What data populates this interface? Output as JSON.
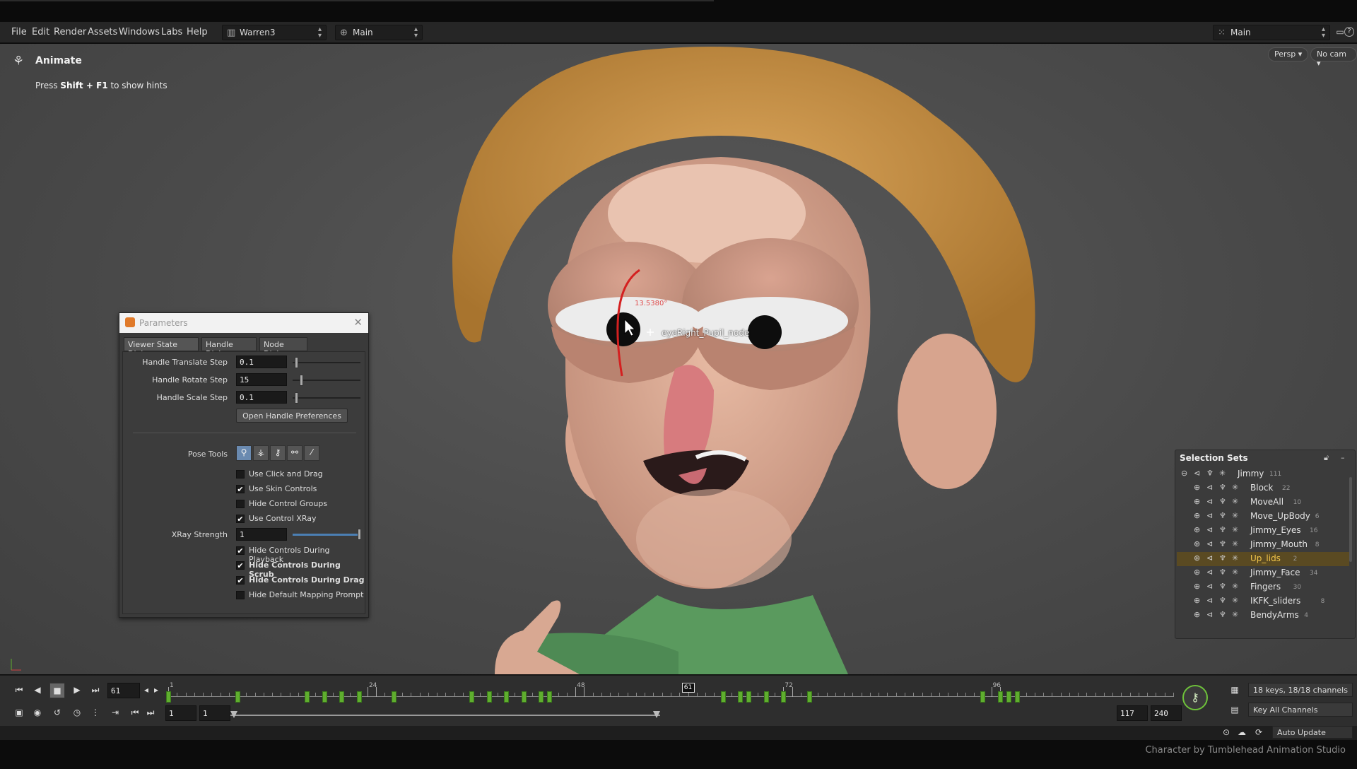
{
  "menubar": {
    "items": [
      "File",
      "Edit",
      "Render",
      "Assets",
      "Windows",
      "Labs",
      "Help"
    ],
    "desktop": "Warren3",
    "context": "Main",
    "right_context": "Main",
    "help_glyph": "?"
  },
  "viewport": {
    "state_title": "Animate",
    "hint_prefix": "Press ",
    "hint_keys": "Shift + F1",
    "hint_suffix": " to show hints",
    "persp_btn": "Persp ▾",
    "cam_btn": "No cam ▾",
    "handle_label": "eyeRight_Pupil_node",
    "handle_value": "13.5380°"
  },
  "parameters": {
    "title": "Parameters",
    "tabs": [
      "Viewer State Dialog",
      "Handle Dialog",
      "Node Dialog"
    ],
    "translate_label": "Handle Translate Step",
    "translate_value": "0.1",
    "rotate_label": "Handle Rotate Step",
    "rotate_value": "15",
    "scale_label": "Handle Scale Step",
    "scale_value": "0.1",
    "open_prefs": "Open Handle Preferences",
    "pose_tools_label": "Pose Tools",
    "checks": [
      {
        "label": "Use Click and Drag",
        "checked": false,
        "bold": false
      },
      {
        "label": "Use Skin Controls",
        "checked": true,
        "bold": false
      },
      {
        "label": "Hide Control Groups",
        "checked": false,
        "bold": false
      },
      {
        "label": "Use Control XRay",
        "checked": true,
        "bold": false
      }
    ],
    "xray_label": "XRay Strength",
    "xray_value": "1",
    "checks2": [
      {
        "label": "Hide Controls During Playback",
        "checked": true,
        "bold": false
      },
      {
        "label": "Hide Controls During Scrub",
        "checked": true,
        "bold": true
      },
      {
        "label": "Hide Controls During Drag",
        "checked": true,
        "bold": true
      },
      {
        "label": "Hide Default Mapping Prompt",
        "checked": false,
        "bold": false
      }
    ]
  },
  "selection_sets": {
    "title": "Selection Sets",
    "rows": [
      {
        "name": "Jimmy",
        "count": "111",
        "level": 0,
        "highlight": false
      },
      {
        "name": "Block",
        "count": "22",
        "level": 1,
        "highlight": false
      },
      {
        "name": "MoveAll",
        "count": "10",
        "level": 1,
        "highlight": false
      },
      {
        "name": "Move_UpBody",
        "count": "6",
        "level": 1,
        "highlight": false
      },
      {
        "name": "Jimmy_Eyes",
        "count": "16",
        "level": 1,
        "highlight": false
      },
      {
        "name": "Jimmy_Mouth",
        "count": "8",
        "level": 1,
        "highlight": false
      },
      {
        "name": "Up_lids",
        "count": "2",
        "level": 1,
        "highlight": true
      },
      {
        "name": "Jimmy_Face",
        "count": "34",
        "level": 1,
        "highlight": false
      },
      {
        "name": "Fingers",
        "count": "30",
        "level": 1,
        "highlight": false
      },
      {
        "name": "IKFK_sliders",
        "count": "8",
        "level": 1,
        "highlight": false
      },
      {
        "name": "BendyArms",
        "count": "4",
        "level": 1,
        "highlight": false
      }
    ]
  },
  "timeline": {
    "current_frame": "61",
    "playhead_label": "61",
    "frame_labels": [
      "1",
      "24",
      "48",
      "72",
      "96"
    ],
    "keyframes": [
      1,
      9,
      17,
      19,
      21,
      23,
      27,
      36,
      38,
      40,
      42,
      44,
      45,
      65,
      67,
      68,
      70,
      72,
      75,
      95,
      97,
      98,
      99
    ],
    "start_field": "1",
    "start_field2": "1",
    "end_field": "117",
    "total_field": "240",
    "key_info": "18 keys, 18/18 channels",
    "key_all": "Key All Channels",
    "auto_update": "Auto Update"
  },
  "credit": "Character by Tumblehead Animation Studio"
}
